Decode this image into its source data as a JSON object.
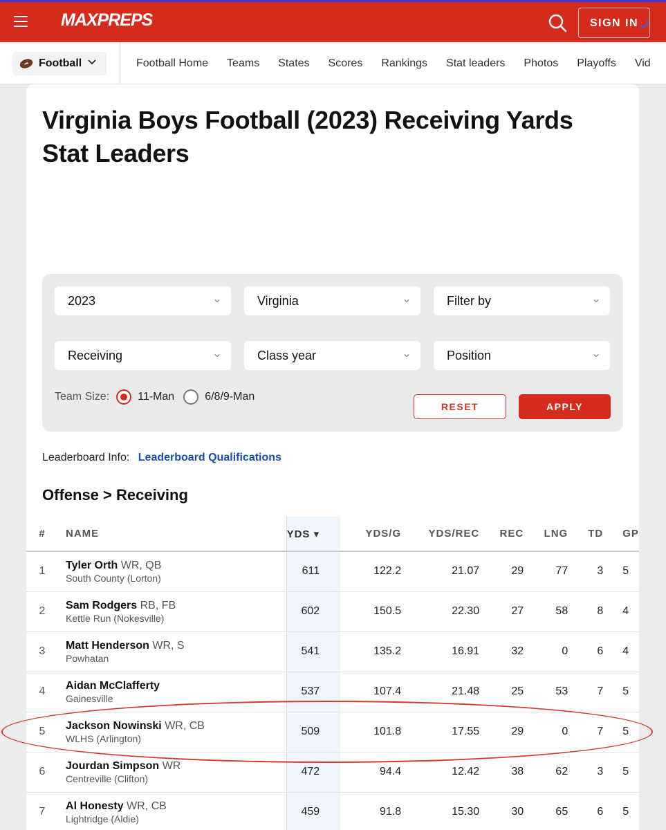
{
  "header": {
    "logo": "MAXPREPS",
    "sign_in": "SIGN IN",
    "brand_color": "#d52b1e"
  },
  "subnav": {
    "sport": "Football",
    "links": [
      "Football Home",
      "Teams",
      "States",
      "Scores",
      "Rankings",
      "Stat leaders",
      "Photos",
      "Playoffs",
      "Vid"
    ]
  },
  "page_title": "Virginia Boys Football (2023) Receiving Yards Stat Leaders",
  "filters": {
    "year": "2023",
    "state": "Virginia",
    "filter_by": "Filter by",
    "category": "Receiving",
    "class_year": "Class year",
    "position": "Position",
    "team_size_label": "Team Size:",
    "team_size_options": [
      "11-Man",
      "6/8/9-Man"
    ],
    "team_size_selected": "11-Man",
    "reset": "RESET",
    "apply": "APPLY"
  },
  "leaderboard_info": {
    "label": "Leaderboard Info:",
    "link": "Leaderboard Qualifications"
  },
  "section_title": "Offense > Receiving",
  "table": {
    "headers": {
      "rank": "#",
      "name": "NAME",
      "yds": "YDS ▾",
      "ydsg": "YDS/G",
      "ydsrec": "YDS/REC",
      "rec": "REC",
      "lng": "LNG",
      "td": "TD",
      "gp": "GP"
    },
    "rows": [
      {
        "rank": "1",
        "name": "Tyler Orth",
        "pos": "WR, QB",
        "school": "South County (Lorton)",
        "yds": "611",
        "ydsg": "122.2",
        "ydsrec": "21.07",
        "rec": "29",
        "lng": "77",
        "td": "3",
        "gp": "5"
      },
      {
        "rank": "2",
        "name": "Sam Rodgers",
        "pos": "RB, FB",
        "school": "Kettle Run (Nokesville)",
        "yds": "602",
        "ydsg": "150.5",
        "ydsrec": "22.30",
        "rec": "27",
        "lng": "58",
        "td": "8",
        "gp": "4"
      },
      {
        "rank": "3",
        "name": "Matt Henderson",
        "pos": "WR, S",
        "school": "Powhatan",
        "yds": "541",
        "ydsg": "135.2",
        "ydsrec": "16.91",
        "rec": "32",
        "lng": "0",
        "td": "6",
        "gp": "4"
      },
      {
        "rank": "4",
        "name": "Aidan McClafferty",
        "pos": "",
        "school": "Gainesville",
        "yds": "537",
        "ydsg": "107.4",
        "ydsrec": "21.48",
        "rec": "25",
        "lng": "53",
        "td": "7",
        "gp": "5"
      },
      {
        "rank": "5",
        "name": "Jackson Nowinski",
        "pos": "WR, CB",
        "school": "WLHS (Arlington)",
        "yds": "509",
        "ydsg": "101.8",
        "ydsrec": "17.55",
        "rec": "29",
        "lng": "0",
        "td": "7",
        "gp": "5"
      },
      {
        "rank": "6",
        "name": "Jourdan Simpson",
        "pos": "WR",
        "school": "Centreville (Clifton)",
        "yds": "472",
        "ydsg": "94.4",
        "ydsrec": "12.42",
        "rec": "38",
        "lng": "62",
        "td": "3",
        "gp": "5"
      },
      {
        "rank": "7",
        "name": "Al Honesty",
        "pos": "WR, CB",
        "school": "Lightridge (Aldie)",
        "yds": "459",
        "ydsg": "91.8",
        "ydsrec": "15.30",
        "rec": "30",
        "lng": "65",
        "td": "6",
        "gp": "5"
      }
    ]
  },
  "annotation": {
    "highlighted_rank": "5",
    "color": "#d33a2c"
  }
}
